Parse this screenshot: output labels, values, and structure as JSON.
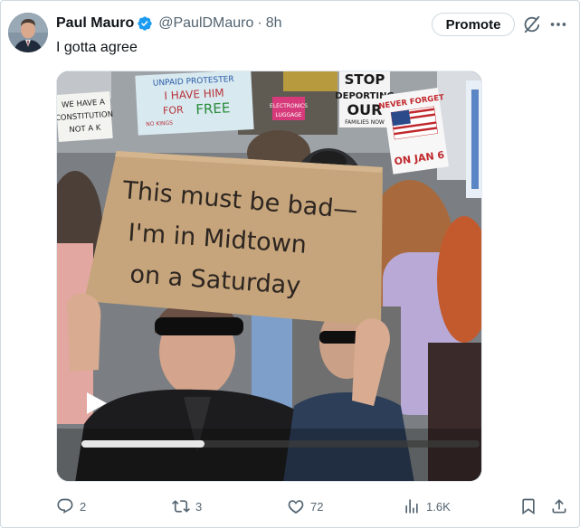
{
  "post": {
    "author_name": "Paul Mauro",
    "handle": "@PaulDMauro",
    "separator": "·",
    "time": "8h",
    "text": "I gotta agree",
    "promote_label": "Promote",
    "verified_color": "#1d9bf0"
  },
  "media": {
    "sign_main": [
      "This must be bad—",
      "I'm in Midtown",
      "on a Saturday"
    ],
    "sign_unpaid": [
      "UNPAID PROTESTER",
      "I HAVE HIM",
      "FOR",
      "FREE",
      "NO KINGS"
    ],
    "sign_constitution": [
      "WE HAVE A",
      "CONSTITUTION",
      "NOT A K"
    ],
    "sign_stop": [
      "STOP",
      "DEPORTING",
      "OUR",
      "FAMILIES NOW"
    ],
    "sign_never": [
      "NEVER FORGET",
      "ON JAN 6"
    ],
    "sign_electronics": [
      "ELECTRONICS",
      "LUGGAGE"
    ],
    "progress_fraction": 0.31
  },
  "actions": {
    "replies": "2",
    "reposts": "3",
    "likes": "72",
    "views": "1.6K"
  },
  "icons": {
    "verified": "verified-badge-icon",
    "grok": "grok-icon",
    "more": "more-icon",
    "play": "play-icon",
    "reply": "reply-icon",
    "repost": "repost-icon",
    "like": "heart-icon",
    "views": "views-icon",
    "bookmark": "bookmark-icon",
    "share": "share-icon"
  }
}
